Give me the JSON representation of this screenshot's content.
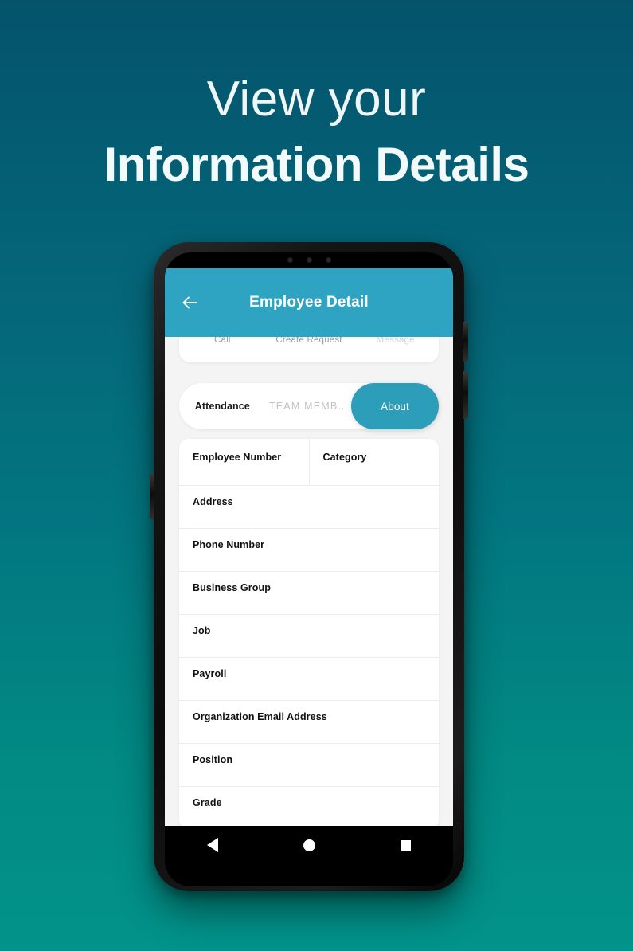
{
  "promo": {
    "line1": "View your",
    "line2": "Information Details"
  },
  "theme": {
    "bg_top": "#04536b",
    "bg_bottom": "#02938a",
    "appbar": "#2ea3c2",
    "accent": "#2d9eba",
    "card": "#ffffff",
    "page": "#f4f4f5",
    "label": "#111113",
    "muted": "#9a9a9e"
  },
  "appbar": {
    "title": "Employee Detail",
    "back_icon": "arrow-left-icon"
  },
  "actions": [
    {
      "label": "Call",
      "icon": "phone-icon",
      "muted": false
    },
    {
      "label": "Create Request",
      "icon": "document-plus-icon",
      "muted": false
    },
    {
      "label": "Message",
      "icon": "message-icon",
      "muted": true
    }
  ],
  "tabs": [
    {
      "label": "Attendance",
      "state": "inactive-dark"
    },
    {
      "label": "TEAM MEMB…",
      "state": "inactive"
    },
    {
      "label": "About",
      "state": "active"
    }
  ],
  "details": {
    "split_row": [
      {
        "label": "Employee Number",
        "value": ""
      },
      {
        "label": "Category",
        "value": ""
      }
    ],
    "rows": [
      {
        "label": "Address",
        "value": ""
      },
      {
        "label": "Phone Number",
        "value": ""
      },
      {
        "label": "Business Group",
        "value": ""
      },
      {
        "label": "Job",
        "value": ""
      },
      {
        "label": "Payroll",
        "value": ""
      },
      {
        "label": "Organization Email Address",
        "value": ""
      },
      {
        "label": "Position",
        "value": ""
      },
      {
        "label": "Grade",
        "value": ""
      }
    ]
  },
  "navbar": [
    {
      "name": "back",
      "icon": "triangle-left-icon"
    },
    {
      "name": "home",
      "icon": "circle-icon"
    },
    {
      "name": "recents",
      "icon": "square-icon"
    }
  ]
}
